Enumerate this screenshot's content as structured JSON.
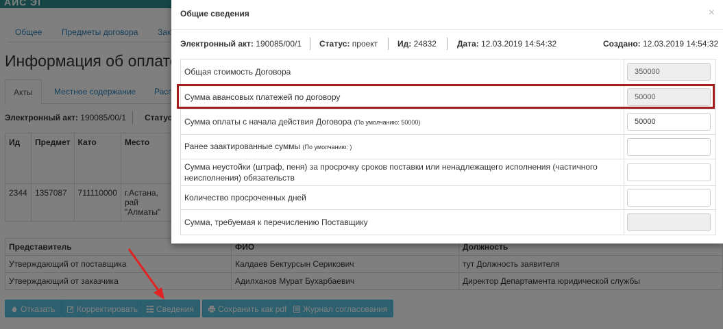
{
  "app": {
    "brand": "АИС ЭГ"
  },
  "background": {
    "tabs": [
      "Общее",
      "Предметы договора",
      "Зак"
    ],
    "page_title": "Информация об оплате",
    "subtabs": [
      "Акты",
      "Местное содержание",
      "Расп"
    ],
    "act_label": "Электронный акт:",
    "act_value": "190085/00/1",
    "status_label": "Статус",
    "table": {
      "headers": [
        "Ид",
        "Предмет",
        "Като",
        "Место"
      ],
      "row": [
        "2344",
        "1357087",
        "711110000",
        "г.Астана, рай \"Алматы\""
      ]
    },
    "reps": {
      "headers": [
        "Представитель",
        "ФИО",
        "Должность"
      ],
      "rows": [
        [
          "Утверждающий от поставщика",
          "Калдаев Бектурсын Серикович",
          "тут Должность заявителя"
        ],
        [
          "Утверждающий от заказчика",
          "Адилханов Мурат Бухарбаевич",
          "Директор Департамента юридической службы"
        ]
      ]
    },
    "buttons": [
      {
        "label": "Отказать",
        "icon": "fire-icon"
      },
      {
        "label": "Корректировать",
        "icon": "edit-icon"
      },
      {
        "label": "Сведения",
        "icon": "list-icon"
      },
      {
        "label": "Сохранить как pdf",
        "icon": "print-icon"
      },
      {
        "label": "Журнал согласования",
        "icon": "journal-icon"
      }
    ]
  },
  "modal": {
    "title": "Общие сведения",
    "close": "×",
    "info": {
      "act_label": "Электронный акт:",
      "act_value": "190085/00/1",
      "status_label": "Статус:",
      "status_value": "проект",
      "id_label": "Ид:",
      "id_value": "24832",
      "date_label": "Дата:",
      "date_value": "12.03.2019 14:54:32",
      "created_label": "Создано:",
      "created_value": "12.03.2019 14:54:32"
    },
    "fields": [
      {
        "label": "Общая стоимость Договора",
        "hint": "",
        "value": "350000",
        "readonly": true
      },
      {
        "label": "Сумма авансовых платежей по договору",
        "hint": "",
        "value": "50000",
        "readonly": true
      },
      {
        "label": "Сумма оплаты с начала действия Договора",
        "hint": "(По умолчанию: 50000)",
        "value": "50000",
        "readonly": false
      },
      {
        "label": "Ранее заактированные суммы",
        "hint": "(По умолчанию: )",
        "value": "",
        "readonly": false
      },
      {
        "label": "Сумма неустойки (штраф, пеня) за просрочку сроков поставки или ненадлежащего исполнения (частичного неисполнения) обязательств",
        "hint": "",
        "value": "",
        "readonly": false
      },
      {
        "label": "Количество просроченных дней",
        "hint": "",
        "value": "",
        "readonly": false
      },
      {
        "label": "Сумма, требуемая к перечислению Поставщику",
        "hint": "",
        "value": "",
        "readonly": true
      }
    ]
  },
  "colors": {
    "accent": "#5bc0de",
    "highlight": "#a31d1d",
    "link": "#2a7fb8"
  }
}
